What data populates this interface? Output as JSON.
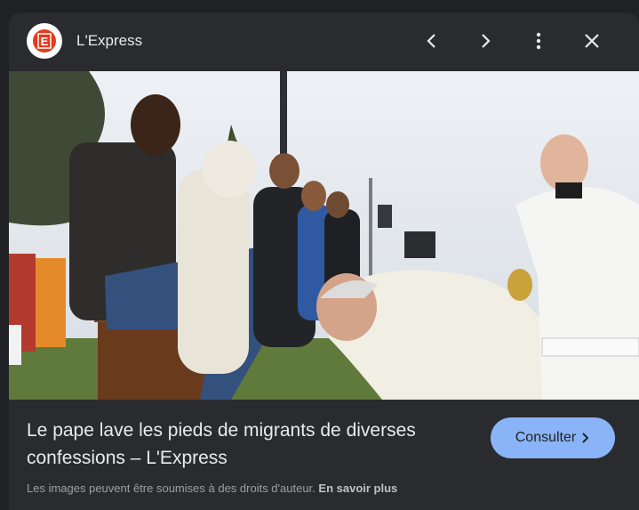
{
  "header": {
    "source_name": "L'Express",
    "logo_letter": "E",
    "icons": [
      "chevron-left-icon",
      "chevron-right-icon",
      "more-vert-icon",
      "close-icon"
    ]
  },
  "image": {
    "subject": "photo"
  },
  "caption": {
    "title": "Le pape lave les pieds de migrants de diverses confessions – L'Express"
  },
  "action": {
    "label": "Consulter",
    "icon": "chevron-right-icon"
  },
  "footer": {
    "copyright_text": "Les images peuvent être soumises à des droits d'auteur.",
    "learn_more": "En savoir plus"
  },
  "colors": {
    "background": "#202124",
    "panel": "#2a2b2e",
    "button": "#8ab4f8",
    "logo_red": "#e43a1b"
  }
}
